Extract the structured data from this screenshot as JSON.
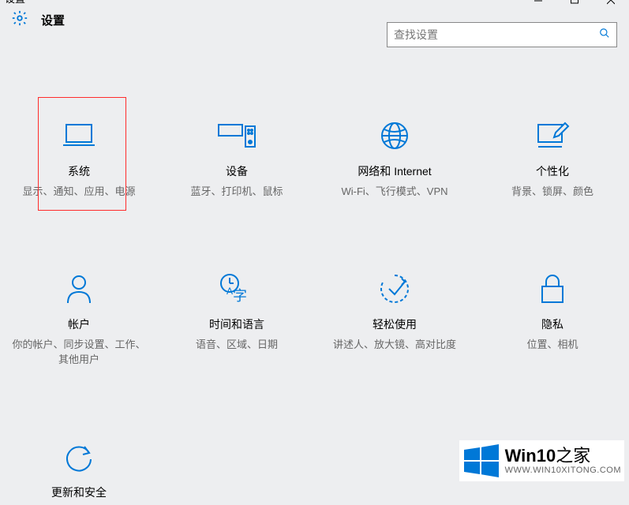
{
  "window": {
    "title_fragment": "设置",
    "app_title": "设置"
  },
  "search": {
    "placeholder": "查找设置"
  },
  "tiles": [
    {
      "id": "system",
      "title": "系统",
      "desc": "显示、通知、应用、电源",
      "icon": "laptop-icon"
    },
    {
      "id": "devices",
      "title": "设备",
      "desc": "蓝牙、打印机、鼠标",
      "icon": "devices-icon"
    },
    {
      "id": "network",
      "title": "网络和 Internet",
      "desc": "Wi-Fi、飞行模式、VPN",
      "icon": "globe-icon"
    },
    {
      "id": "personalization",
      "title": "个性化",
      "desc": "背景、锁屏、颜色",
      "icon": "pen-icon"
    },
    {
      "id": "accounts",
      "title": "帐户",
      "desc": "你的帐户、同步设置、工作、其他用户",
      "icon": "person-icon"
    },
    {
      "id": "time",
      "title": "时间和语言",
      "desc": "语音、区域、日期",
      "icon": "time-lang-icon"
    },
    {
      "id": "ease",
      "title": "轻松使用",
      "desc": "讲述人、放大镜、高对比度",
      "icon": "ease-icon"
    },
    {
      "id": "privacy",
      "title": "隐私",
      "desc": "位置、相机",
      "icon": "lock-icon"
    },
    {
      "id": "update",
      "title": "更新和安全",
      "desc": "",
      "icon": "update-icon"
    }
  ],
  "watermark": {
    "brand": "Win10",
    "suffix": "之家",
    "url": "WWW.WIN10XITONG.COM"
  },
  "colors": {
    "accent": "#0078d7",
    "highlight": "#ff2c2c"
  }
}
